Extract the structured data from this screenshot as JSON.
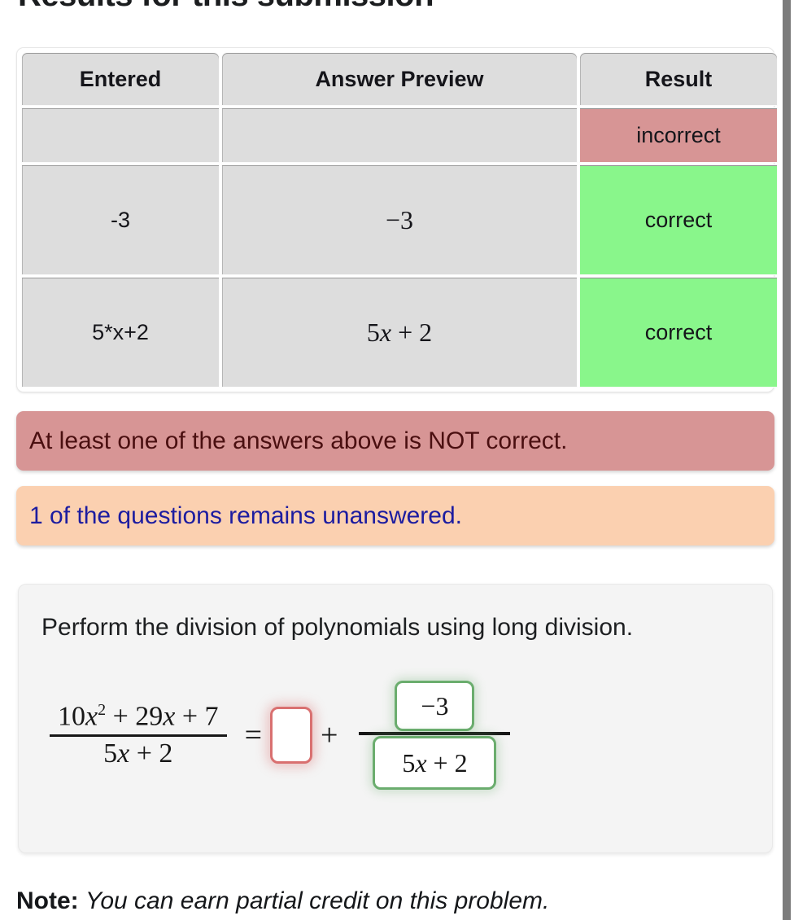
{
  "page": {
    "title": "Results for this submission",
    "note_label": "Note:",
    "note_body": "You can earn partial credit on this problem."
  },
  "results_table": {
    "columns": [
      "Entered",
      "Answer Preview",
      "Result"
    ],
    "rows": [
      {
        "entered": "",
        "preview": "",
        "result": "incorrect",
        "status": "incorrect"
      },
      {
        "entered": "-3",
        "preview": "−3",
        "result": "correct",
        "status": "correct"
      },
      {
        "entered": "5*x+2",
        "preview": "5x + 2",
        "result": "correct",
        "status": "correct"
      }
    ]
  },
  "alerts": [
    {
      "type": "danger",
      "text": "At least one of the answers above is NOT correct."
    },
    {
      "type": "warning",
      "text": "1 of the questions remains unanswered."
    }
  ],
  "problem": {
    "prompt": "Perform the division of polynomials using long division.",
    "equation": {
      "left_numerator": "10x² + 29x + 7",
      "left_denominator": "5x + 2",
      "equals": "=",
      "answer_blank_value": "",
      "plus": "+",
      "right_numerator": "−3",
      "right_denominator": "5x + 2"
    }
  },
  "colors": {
    "correct_bg": "#89f68b",
    "incorrect_bg": "#d79595",
    "result_text": "#18197e",
    "alert_danger_bg": "#d79595",
    "alert_danger_text": "#4a0f10",
    "alert_warning_bg": "#fbd0b0",
    "alert_warning_text": "#1c1ca0",
    "cell_bg": "#dddddd",
    "card_bg": "#f4f4f4",
    "answer_blank_border": "#d97070",
    "answer_box_border": "#6bad6e",
    "scrollbar": "#7b7b7b"
  }
}
